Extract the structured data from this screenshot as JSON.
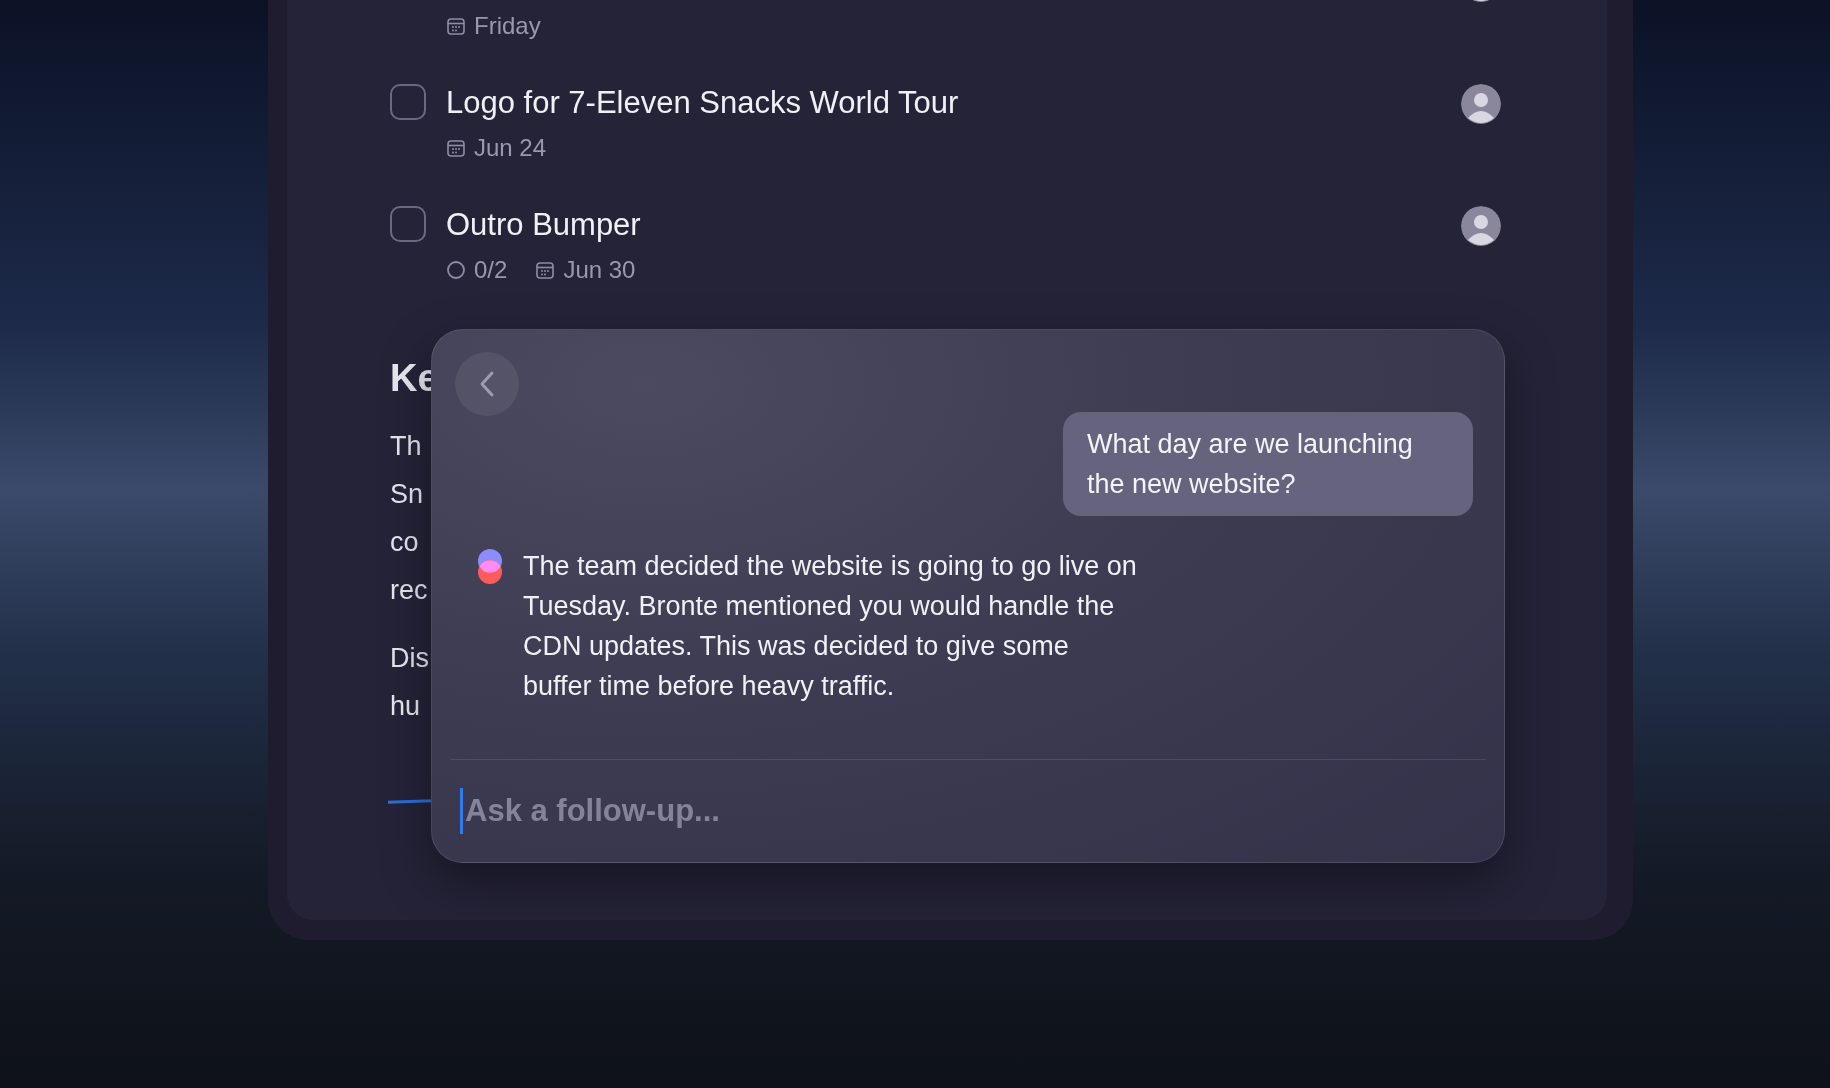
{
  "tasks": [
    {
      "meta": [
        {
          "kind": "date",
          "text": "Friday"
        }
      ]
    },
    {
      "checked": false,
      "title": "Logo for 7-Eleven Snacks World Tour",
      "meta": [
        {
          "kind": "date",
          "text": "Jun 24"
        }
      ]
    },
    {
      "checked": false,
      "title": "Outro Bumper",
      "meta": [
        {
          "kind": "subtasks",
          "text": "0/2"
        },
        {
          "kind": "date",
          "text": "Jun 30"
        }
      ]
    }
  ],
  "notes": {
    "heading": "Ke",
    "paragraphs": [
      [
        "Th",
        "Sn",
        "co",
        "rec"
      ],
      [
        "Dis",
        "hu"
      ]
    ]
  },
  "assistant": {
    "question": "What day are we launching the new website?",
    "answer": "The team decided the website is going to go live on Tuesday. Bronte mentioned you would handle the CDN updates. This was decided to give some buffer time before heavy traffic.",
    "input": {
      "placeholder": "Ask a follow-up..."
    }
  }
}
